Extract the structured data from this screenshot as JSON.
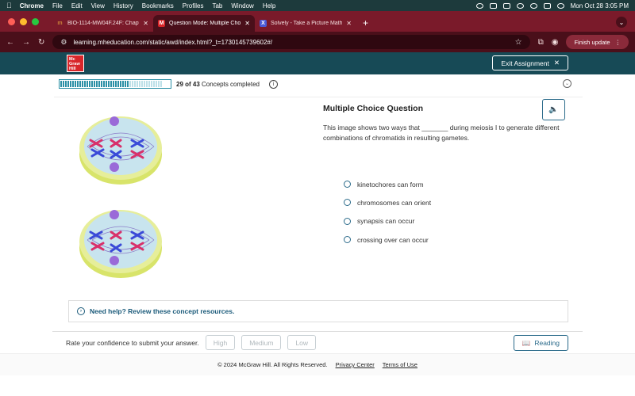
{
  "menubar": {
    "items": [
      "Chrome",
      "File",
      "Edit",
      "View",
      "History",
      "Bookmarks",
      "Profiles",
      "Tab",
      "Window",
      "Help"
    ],
    "datetime": "Mon Oct 28  3:05 PM"
  },
  "browser": {
    "tabs": [
      {
        "title": "BIO-1114-MW04F.24F: Chapt",
        "favicon": "m",
        "favicon_color": "#c8803a"
      },
      {
        "title": "Question Mode: Multiple Cho",
        "favicon": "M",
        "favicon_color": "#d8262a"
      },
      {
        "title": "Solvely - Take a Picture Math",
        "favicon": "X",
        "favicon_color": "#4a5ad8"
      }
    ],
    "url": "learning.mheducation.com/static/awd/index.html?_t=1730145739602#/",
    "finish_update": "Finish update"
  },
  "header": {
    "logo_lines": [
      "Mc",
      "Graw",
      "Hill"
    ],
    "exit_label": "Exit Assignment"
  },
  "progress": {
    "count": "29 of 43",
    "label": "Concepts completed",
    "completed": 29,
    "total": 43
  },
  "question": {
    "title": "Multiple Choice Question",
    "text": "This image shows two ways that _______ during meiosis I to generate different combinations of chromatids in resulting gametes.",
    "options": [
      "kinetochores can form",
      "chromosomes can orient",
      "synapsis can occur",
      "crossing over can occur"
    ]
  },
  "help": {
    "label": "Need help? Review these concept resources."
  },
  "confidence": {
    "prompt": "Rate your confidence to submit your answer.",
    "levels": [
      "High",
      "Medium",
      "Low"
    ],
    "reading_label": "Reading"
  },
  "footer": {
    "copyright": "© 2024 McGraw Hill. All Rights Reserved.",
    "privacy": "Privacy Center",
    "terms": "Terms of Use"
  },
  "colors": {
    "brand_bar": "#174a56",
    "browser_accent": "#7a1a2a",
    "link": "#1a5a7a",
    "progress": "#2a8fa5"
  }
}
